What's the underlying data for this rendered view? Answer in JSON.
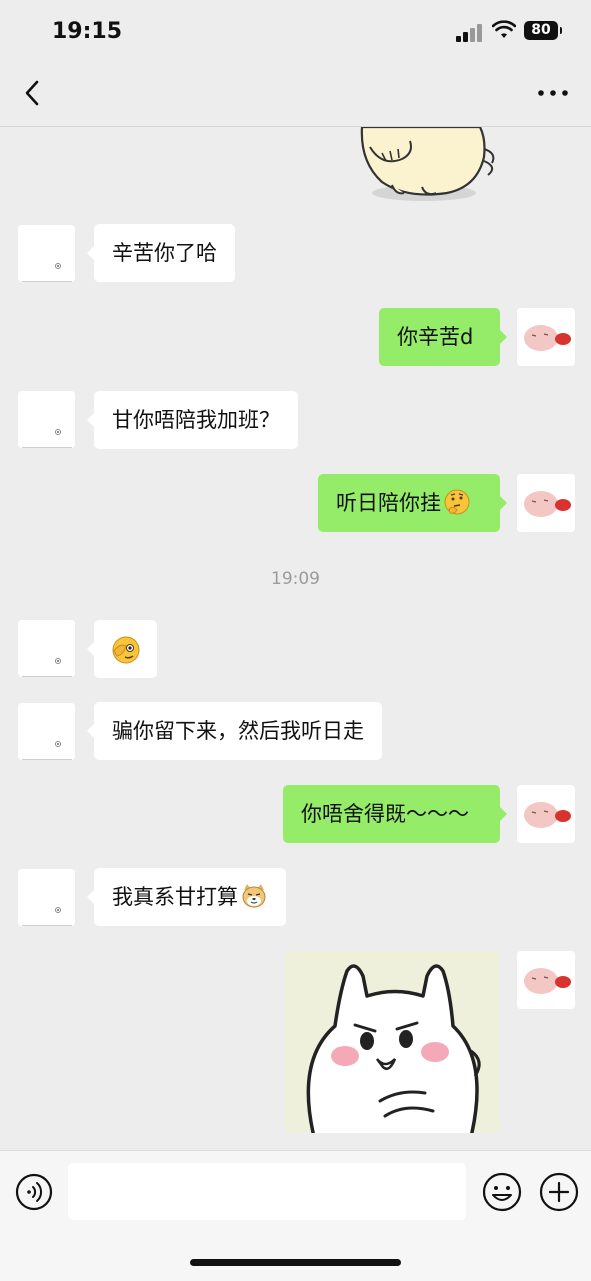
{
  "status": {
    "time": "19:15",
    "battery": "80"
  },
  "header": {
    "title": ""
  },
  "messages": [
    {
      "side": "in",
      "text": "辛苦你了哈",
      "emoji": ""
    },
    {
      "side": "out",
      "text": "你辛苦d",
      "emoji": ""
    },
    {
      "side": "in",
      "text": "甘你唔陪我加班？",
      "emoji": ""
    },
    {
      "side": "out",
      "text": "听日陪你挂",
      "emoji": "thinking-face"
    },
    {
      "side": "in",
      "text": "",
      "emoji": "facepalm-peek"
    },
    {
      "side": "in",
      "text": "骗你留下来，然后我听日走",
      "emoji": ""
    },
    {
      "side": "out",
      "text": "你唔舍得既～～～",
      "emoji": ""
    },
    {
      "side": "in",
      "text": "我真系甘打算",
      "emoji": "doge-cat"
    },
    {
      "side": "out",
      "text": "",
      "emoji": "white-bunny-sticker"
    }
  ],
  "time_divider": "19:09",
  "input": {
    "value": "",
    "placeholder": ""
  },
  "colors": {
    "background": "#ededed",
    "outgoing_bubble": "#95ec69",
    "incoming_bubble": "#ffffff"
  }
}
